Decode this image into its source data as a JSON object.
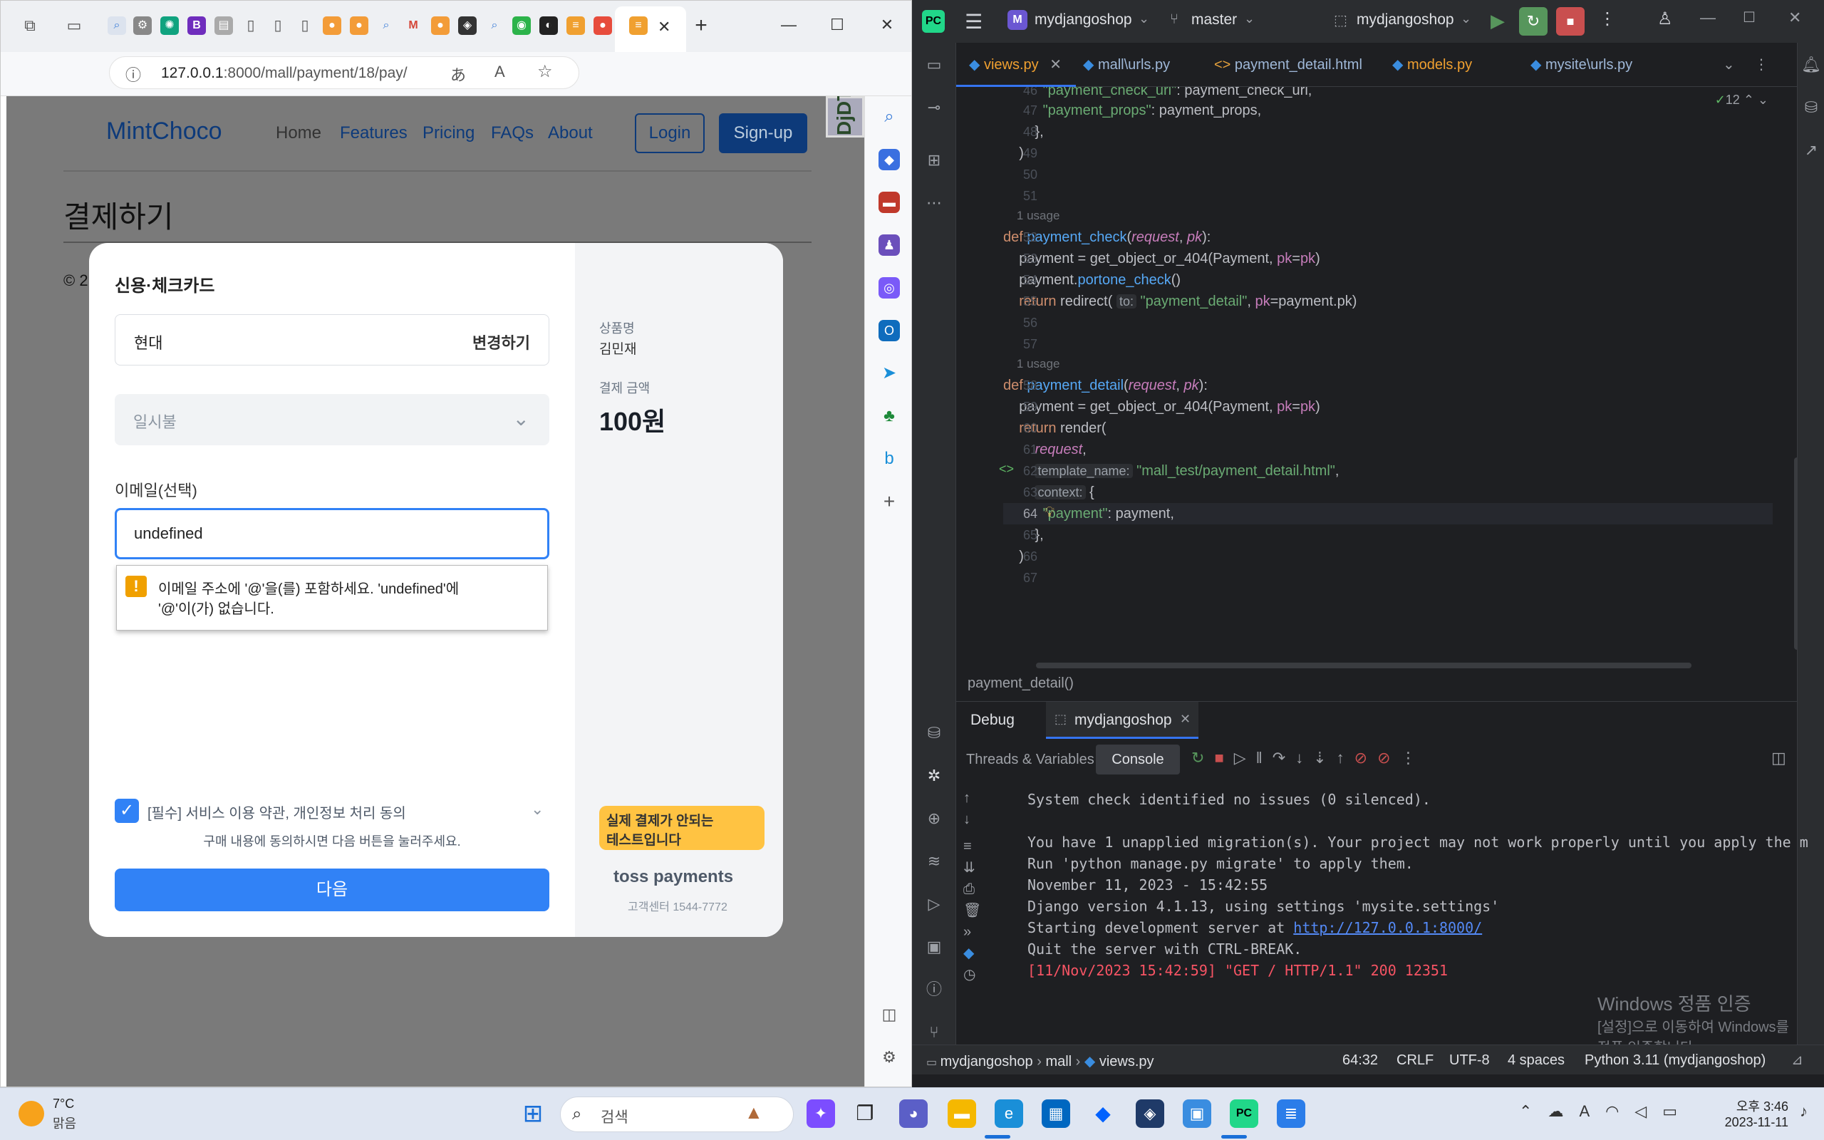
{
  "browser": {
    "url": "127.0.0.1:8000/mall/payment/18/pay/",
    "url_host": "127.0.0.1",
    "url_rest": ":8000/mall/payment/18/pay/",
    "reader_icon": "ꭺ",
    "readaloud_icon": "A"
  },
  "site": {
    "brand": "MintChoco",
    "nav": [
      "Home",
      "Features",
      "Pricing",
      "FAQs",
      "About"
    ],
    "login": "Login",
    "signup": "Sign-up",
    "page_title": "결제하기",
    "footer_prefix": "© 2",
    "djdt": "DjDT"
  },
  "modal": {
    "title": "신용·체크카드",
    "card_company": "현대",
    "change_button": "변경하기",
    "installment": "일시불",
    "email_label": "이메일(선택)",
    "email_value": "undefined",
    "validation_message_1": "이메일 주소에 '@'을(를) 포함하세요. 'undefined'에",
    "validation_message_2": "'@'이(가) 없습니다.",
    "consent_label": "[필수] 서비스 이용 약관, 개인정보 처리 동의",
    "consent_hint": "구매 내용에 동의하시면 다음 버튼을 눌러주세요.",
    "next_button": "다음",
    "product_label": "상품명",
    "product_name": "김민재",
    "amount_label": "결제 금액",
    "amount": "100원",
    "test_badge_1": "실제 결제가 안되는",
    "test_badge_2": "테스트입니다",
    "toss_logo": "toss payments",
    "customer_center": "고객센터 1544-7772"
  },
  "ide": {
    "project": "mydjangoshop",
    "project_initial": "M",
    "branch": "master",
    "run_config": "mydjangoshop",
    "tabs": [
      "views.py",
      "mall\\urls.py",
      "payment_detail.html",
      "models.py",
      "mysite\\urls.py"
    ],
    "inspection_count": "12",
    "usage_hint": "1 usage",
    "breadcrumb": "payment_detail()",
    "debug_tab": "Debug",
    "debug_session": "mydjangoshop",
    "threads_tab": "Threads & Variables",
    "console_tab": "Console",
    "console": [
      "System check identified no issues (0 silenced).",
      "",
      "You have 1 unapplied migration(s). Your project may not work properly until you apply the m",
      "Run 'python manage.py migrate' to apply them.",
      "November 11, 2023 - 15:42:55",
      "Django version 4.1.13, using settings 'mysite.settings'",
      "Starting development server at ",
      "Quit the server with CTRL-BREAK.",
      "[11/Nov/2023 15:42:59] \"GET / HTTP/1.1\" 200 12351"
    ],
    "server_url": "http://127.0.0.1:8000/",
    "watermark_1": "Windows 정품 인증",
    "watermark_2": "[설정]으로 이동하여 Windows를 정품 인증합니다.",
    "status": {
      "crumb_project": "mydjangoshop",
      "crumb_folder": "mall",
      "crumb_file": "views.py",
      "position": "64:32",
      "line_sep": "CRLF",
      "encoding": "UTF-8",
      "indent": "4 spaces",
      "interpreter": "Python 3.11 (mydjangoshop)"
    }
  },
  "taskbar": {
    "temp": "7°C",
    "weather": "맑음",
    "search_placeholder": "검색",
    "time": "오후 3:46",
    "date": "2023-11-11"
  }
}
